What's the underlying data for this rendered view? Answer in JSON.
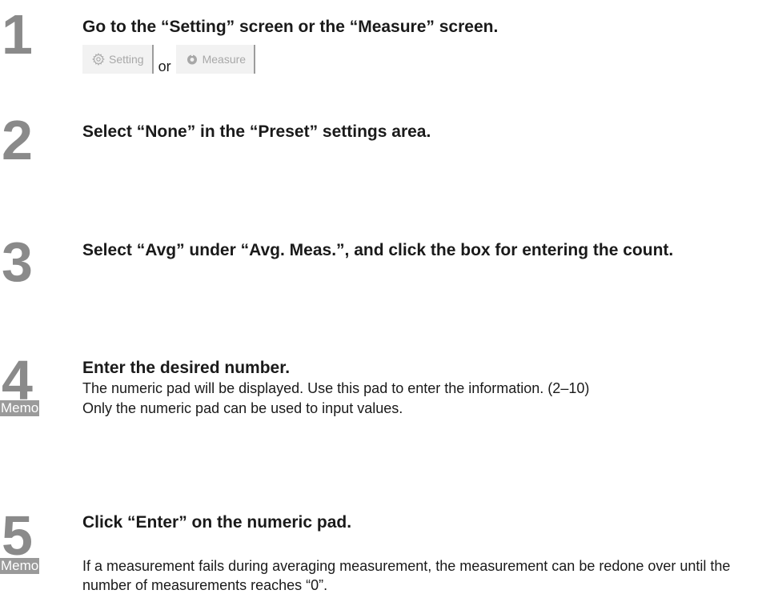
{
  "steps": [
    {
      "number": "1",
      "title": "Go to the “Setting” screen or the “Measure” screen.",
      "buttons": {
        "setting_label": "Setting",
        "setting_icon": "gear-icon",
        "or_text": "or",
        "measure_label": "Measure",
        "measure_icon": "measure-icon"
      }
    },
    {
      "number": "2",
      "title": "Select “None” in the “Preset” settings area."
    },
    {
      "number": "3",
      "title": "Select “Avg” under “Avg. Meas.”, and click the box for entering the count."
    },
    {
      "number": "4",
      "title": "Enter the desired number.",
      "body": "The numeric pad will be displayed. Use this pad to enter the information. (2–10)",
      "memo_label": "Memo",
      "memo_text": "Only the numeric pad can be used to input values."
    },
    {
      "number": "5",
      "title": "Click “Enter” on the numeric pad.",
      "memo_label": "Memo",
      "memo_text": "If a measurement fails during averaging measurement, the measurement can be redone over until the number of measurements reaches “0”."
    }
  ],
  "colors": {
    "step_number": "#8a8a8a",
    "memo_bg": "#9a9a9a",
    "button_bg": "#f2f2f2",
    "button_text": "#a8a8a8"
  }
}
